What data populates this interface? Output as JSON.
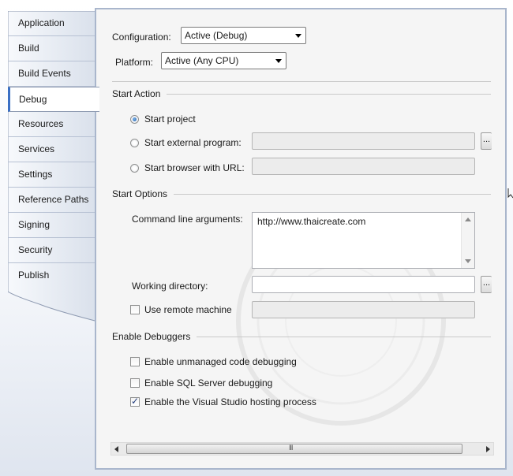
{
  "sidebar": {
    "items": [
      {
        "label": "Application"
      },
      {
        "label": "Build"
      },
      {
        "label": "Build Events"
      },
      {
        "label": "Debug",
        "selected": true
      },
      {
        "label": "Resources"
      },
      {
        "label": "Services"
      },
      {
        "label": "Settings"
      },
      {
        "label": "Reference Paths"
      },
      {
        "label": "Signing"
      },
      {
        "label": "Security"
      },
      {
        "label": "Publish"
      }
    ]
  },
  "config": {
    "configuration_label": "Configuration:",
    "configuration_value": "Active (Debug)",
    "platform_label": "Platform:",
    "platform_value": "Active (Any CPU)"
  },
  "start_action": {
    "title": "Start Action",
    "start_project": "Start project",
    "start_external": "Start external program:",
    "start_browser": "Start browser with URL:",
    "browse_label": "..."
  },
  "start_options": {
    "title": "Start Options",
    "cmd_label": "Command line arguments:",
    "cmd_value": "http://www.thaicreate.com",
    "working_dir_label": "Working directory:",
    "browse_label": "...",
    "remote_label": "Use remote machine"
  },
  "debuggers": {
    "title": "Enable Debuggers",
    "unmanaged": "Enable unmanaged code debugging",
    "sql": "Enable SQL Server debugging",
    "vshost": "Enable the Visual Studio hosting process",
    "unmanaged_checked": false,
    "sql_checked": false,
    "vshost_checked": true
  },
  "scrollbar": {
    "grip": "III"
  },
  "colors": {
    "accent": "#3a6fc4",
    "panel_bg": "#f5f5f5",
    "panel_border": "#a9b6cc"
  },
  "icons": {
    "dropdown": "chevron-down-icon",
    "checkmark": "check-icon",
    "cursor": "mouse-pointer-icon"
  }
}
